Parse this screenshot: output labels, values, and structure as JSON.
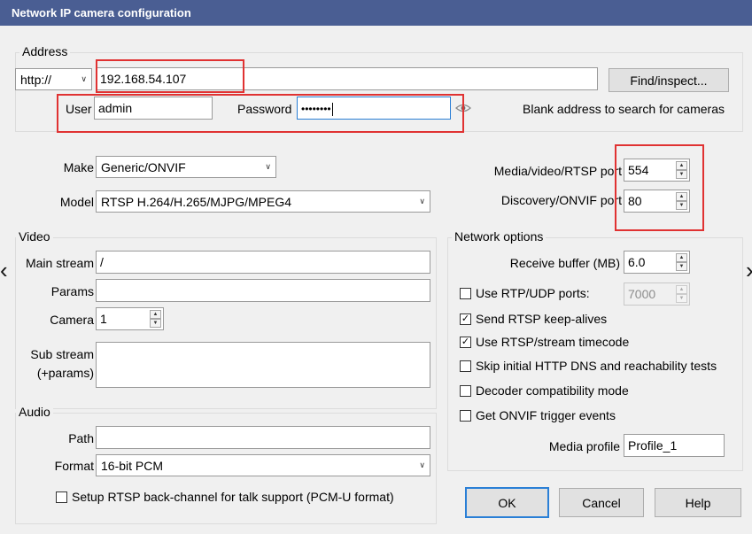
{
  "window": {
    "title": "Network IP camera configuration"
  },
  "address": {
    "group_title": "Address",
    "scheme": "http://",
    "url": "192.168.54.107",
    "find_button": "Find/inspect...",
    "user_label": "User",
    "user_value": "admin",
    "password_label": "Password",
    "password_mask": "••••••••",
    "hint": "Blank address to search for cameras"
  },
  "device": {
    "make_label": "Make",
    "make_value": "Generic/ONVIF",
    "model_label": "Model",
    "model_value": "RTSP H.264/H.265/MJPG/MPEG4",
    "media_port_label": "Media/video/RTSP port",
    "media_port_value": "554",
    "discovery_port_label": "Discovery/ONVIF port",
    "discovery_port_value": "80"
  },
  "video": {
    "group_title": "Video",
    "main_stream_label": "Main stream",
    "main_stream_value": "/",
    "params_label": "Params",
    "params_value": "",
    "camera_label": "Camera",
    "camera_value": "1",
    "sub_stream_label_1": "Sub stream",
    "sub_stream_label_2": "(+params)",
    "sub_stream_value": ""
  },
  "audio": {
    "group_title": "Audio",
    "path_label": "Path",
    "path_value": "",
    "format_label": "Format",
    "format_value": "16-bit PCM",
    "backchannel_label": "Setup RTSP back-channel for talk support (PCM-U format)",
    "backchannel_checked": false
  },
  "network": {
    "group_title": "Network options",
    "receive_buffer_label": "Receive buffer (MB)",
    "receive_buffer_value": "6.0",
    "rtp_udp_label": "Use RTP/UDP ports:",
    "rtp_udp_value": "7000",
    "keepalives_label": "Send RTSP keep-alives",
    "timecode_label": "Use RTSP/stream timecode",
    "skip_dns_label": "Skip initial HTTP DNS and reachability tests",
    "decoder_compat_label": "Decoder compatibility mode",
    "onvif_trigger_label": "Get ONVIF trigger events",
    "media_profile_label": "Media profile",
    "media_profile_value": "Profile_1"
  },
  "buttons": {
    "ok": "OK",
    "cancel": "Cancel",
    "help": "Help"
  },
  "nav": {
    "prev": "‹",
    "next": "›"
  },
  "colors": {
    "titlebar": "#4a5e93",
    "highlight": "#e03232",
    "default_button": "#2a7fd6"
  }
}
